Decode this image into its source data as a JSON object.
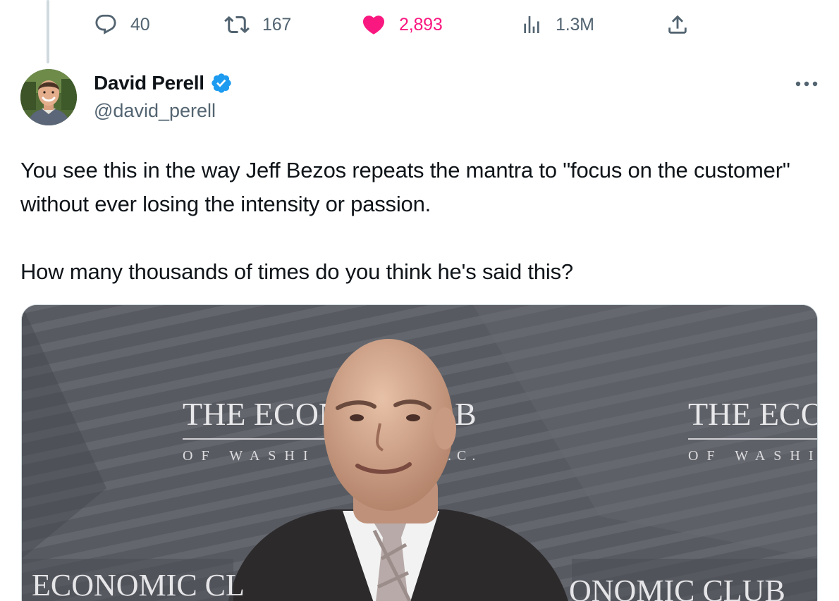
{
  "actions": {
    "replies": "40",
    "retweets": "167",
    "likes": "2,893",
    "views": "1.3M",
    "liked": true,
    "like_color": "#f91880",
    "muted_color": "#536471",
    "icons": [
      "reply-icon",
      "retweet-icon",
      "heart-icon",
      "views-icon",
      "share-icon"
    ]
  },
  "author": {
    "name": "David Perell",
    "handle": "@david_perell",
    "verified": true,
    "verified_color": "#1d9bf0"
  },
  "tweet": {
    "paragraphs": [
      "You see this in the way Jeff Bezos repeats the mantra to \"focus on the customer\" without ever losing the intensity or passion.",
      "How many thousands of times do you think he's said this?"
    ]
  },
  "media": {
    "backdrop_left_title": "THE ECON",
    "backdrop_left_sub": "OF WASHI",
    "backdrop_mid_title": "B",
    "backdrop_mid_sub": ".C.",
    "backdrop_right_title": "THE ECON",
    "backdrop_right_sub": "OF WASHI",
    "banner_left": "ECONOMIC CL",
    "banner_right": "ONOMIC CLUB"
  }
}
